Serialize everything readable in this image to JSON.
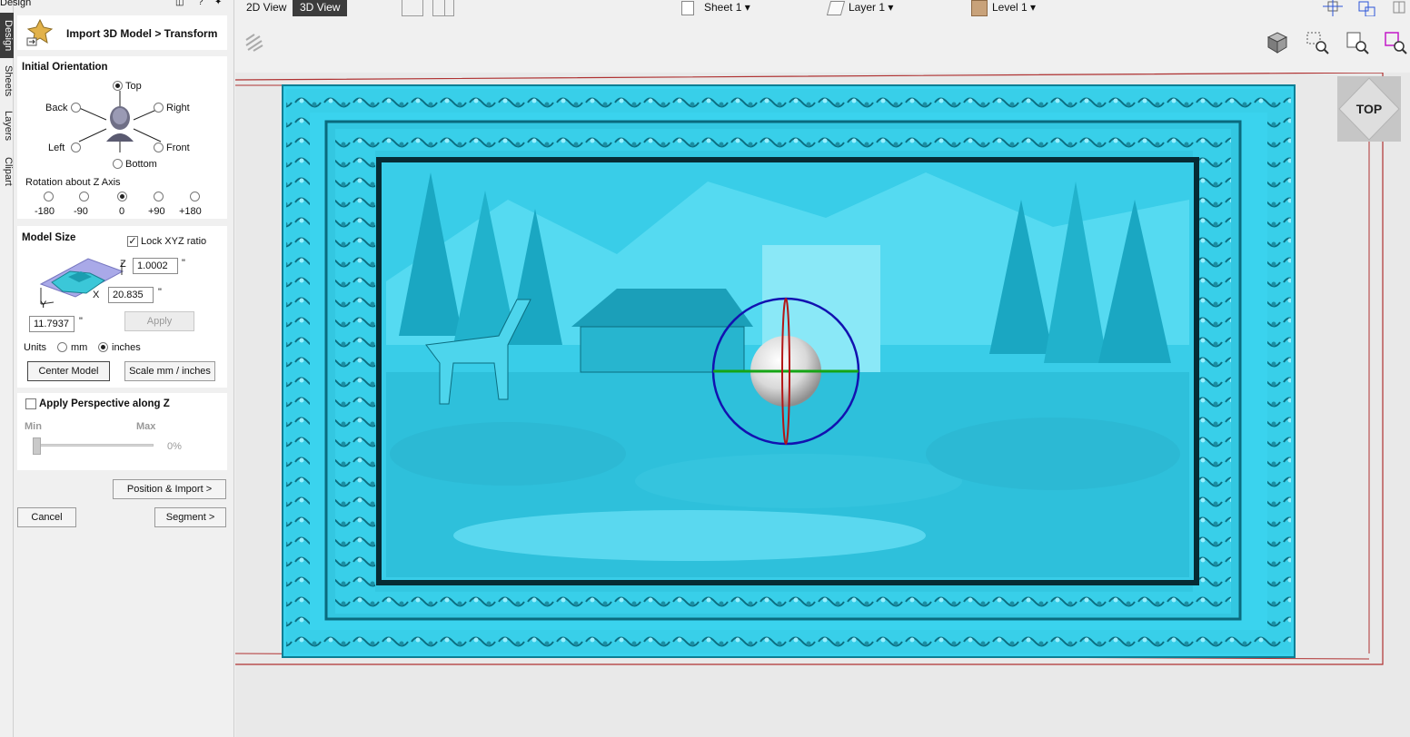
{
  "panel_header": {
    "window_title": "Design"
  },
  "side_tabs": [
    "Design",
    "Sheets",
    "Layers",
    "Clipart"
  ],
  "view_tabs": [
    "2D View",
    "3D View"
  ],
  "toolbar": {
    "sheet": "Sheet 1",
    "layer": "Layer 1",
    "level": "Level 1"
  },
  "cube_label": "TOP",
  "form": {
    "title": "Import 3D Model > Transform",
    "orientation": {
      "heading": "Initial Orientation",
      "options": [
        "Top",
        "Back",
        "Right",
        "Left",
        "Front",
        "Bottom"
      ],
      "selected": "Top",
      "rotation_label": "Rotation about Z Axis",
      "rotation_options": [
        "-180",
        "-90",
        "0",
        "+90",
        "+180"
      ],
      "rotation_selected": "0"
    },
    "size": {
      "heading": "Model Size",
      "lock_label": "Lock XYZ ratio",
      "lock_checked": true,
      "z_label": "Z",
      "x_label": "X",
      "y_label": "Y",
      "z_value": "1.0002",
      "x_value": "20.835",
      "y_value": "11.7937",
      "unit_mark": "\"",
      "apply_label": "Apply",
      "units_label": "Units",
      "unit_mm": "mm",
      "unit_inches": "inches",
      "unit_selected": "inches",
      "center_label": "Center Model",
      "scale_label": "Scale mm / inches"
    },
    "perspective": {
      "label": "Apply Perspective along Z",
      "checked": false,
      "min_label": "Min",
      "max_label": "Max",
      "percent": "0%",
      "level": 0
    },
    "buttons": {
      "position_import": "Position & Import >",
      "cancel": "Cancel",
      "segment": "Segment >"
    }
  },
  "colors": {
    "relief": "#3ad3ee",
    "dark_tab": "#3c3c3c",
    "sphere_ring": "#1212b0"
  }
}
